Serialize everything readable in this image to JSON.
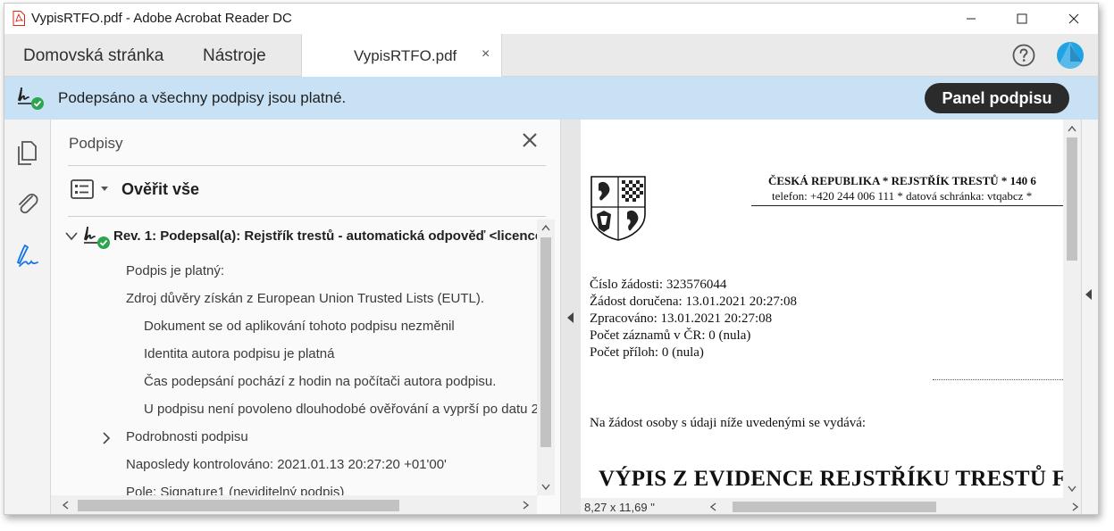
{
  "window": {
    "title": "VypisRTFO.pdf - Adobe Acrobat Reader DC",
    "controls": [
      "minimize",
      "maximize",
      "close"
    ]
  },
  "tabs": {
    "home": "Domovská stránka",
    "tools": "Nástroje",
    "document": "VypisRTFO.pdf",
    "close_glyph": "×"
  },
  "signature_bar": {
    "message": "Podepsáno a všechny podpisy jsou platné.",
    "button": "Panel podpisu"
  },
  "signatures_panel": {
    "title": "Podpisy",
    "validate_all": "Ověřit vše",
    "revision": "Rev. 1: Podepsal(a): Rejstřík trestů - automatická odpověď <licence@",
    "lines": [
      "Podpis je platný:",
      "Zdroj důvěry získán z European Union Trusted Lists (EUTL).",
      "Dokument se od aplikování tohoto podpisu nezměnil",
      "Identita autora podpisu je platná",
      "Čas podepsání pochází z hodin na počítači autora podpisu.",
      "U podpisu není povoleno dlouhodobé ověřování a vyprší po datu 2",
      "Podrobnosti podpisu",
      "Naposledy kontrolováno: 2021.01.13 20:27:20 +01'00'",
      "Pole: Signature1 (neviditelný podpis)"
    ]
  },
  "document": {
    "header_line1": "ČESKÁ REPUBLIKA * REJSTŘÍK TRESTŮ * 140 6",
    "header_line2": "telefon: +420 244 006 111 * datová schránka: vtqabcz *",
    "meta": [
      "Číslo žádosti: 323576044",
      "Žádost doručena: 13.01.2021 20:27:08",
      "Zpracováno: 13.01.2021 20:27:08",
      "Počet záznamů v ČR: 0 (nula)",
      "Počet příloh: 0 (nula)"
    ],
    "request_text": "Na žádost osoby s údaji níže uvedenými se vydává:",
    "big_title": "VÝPIS Z EVIDENCE REJSTŘÍKU TRESTŮ F",
    "page_size": "8,27 x 11,69 \""
  },
  "colors": {
    "banner": "#c8e1f5",
    "accent": "#1fa3e3",
    "valid_green": "#2da44e",
    "button_dark": "#2b2b2b",
    "pdf_red": "#d9261c"
  },
  "icons": {
    "title": "pdf-file-icon",
    "help": "help-circle-icon",
    "signature_valid": "signature-valid-icon",
    "pages": "page-thumbnails-icon",
    "attachments": "paperclip-icon",
    "signatures": "signature-pen-icon",
    "validate": "validate-list-icon"
  }
}
